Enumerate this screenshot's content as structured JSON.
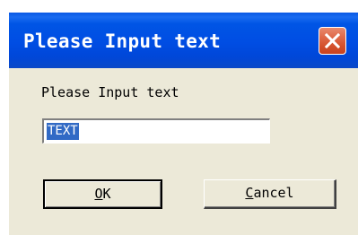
{
  "dialog": {
    "title": "Please Input text",
    "prompt": "Please Input text",
    "input_value": "TEXT",
    "ok_mnemonic": "O",
    "ok_rest": "K",
    "cancel_mnemonic": "C",
    "cancel_rest": "ancel"
  },
  "icons": {
    "close": "close-icon"
  },
  "colors": {
    "titlebar": "#0055e5",
    "close_button": "#d4502c",
    "face": "#ece9d8",
    "selection": "#316ac5"
  }
}
